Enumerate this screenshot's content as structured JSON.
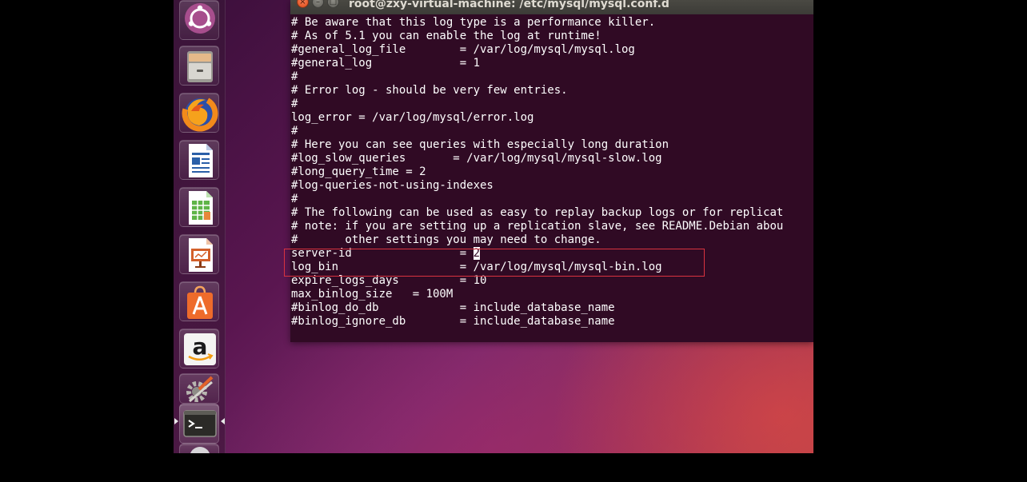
{
  "window": {
    "title": "root@zxy-virtual-machine: /etc/mysql/mysql.conf.d",
    "close_icon": "×",
    "minimize_icon": "–",
    "maximize_icon": "□"
  },
  "launcher": {
    "items": [
      {
        "name": "ubuntu-dash",
        "icon": "ubuntu-logo-icon"
      },
      {
        "name": "files",
        "icon": "file-cabinet-icon"
      },
      {
        "name": "firefox",
        "icon": "firefox-icon"
      },
      {
        "name": "libreoffice-writer",
        "icon": "writer-document-icon"
      },
      {
        "name": "libreoffice-calc",
        "icon": "calc-spreadsheet-icon"
      },
      {
        "name": "libreoffice-impress",
        "icon": "impress-presentation-icon"
      },
      {
        "name": "ubuntu-software",
        "icon": "shopping-bag-icon"
      },
      {
        "name": "amazon",
        "icon": "amazon-icon"
      },
      {
        "name": "system-settings",
        "icon": "settings-tools-icon"
      },
      {
        "name": "terminal",
        "icon": "terminal-icon",
        "active": true
      },
      {
        "name": "dvd",
        "icon": "disc-icon"
      }
    ]
  },
  "terminal": {
    "lines": [
      "# Be aware that this log type is a performance killer.",
      "# As of 5.1 you can enable the log at runtime!",
      "#general_log_file        = /var/log/mysql/mysql.log",
      "#general_log             = 1",
      "#",
      "# Error log - should be very few entries.",
      "#",
      "log_error = /var/log/mysql/error.log",
      "#",
      "# Here you can see queries with especially long duration",
      "#log_slow_queries       = /var/log/mysql/mysql-slow.log",
      "#long_query_time = 2",
      "#log-queries-not-using-indexes",
      "#",
      "# The following can be used as easy to replay backup logs or for replicat",
      "# note: if you are setting up a replication slave, see README.Debian abou",
      "#       other settings you may need to change.",
      "server-id                = ",
      "log_bin                  = /var/log/mysql/mysql-bin.log",
      "expire_logs_days         = 10",
      "max_binlog_size   = 100M",
      "#binlog_do_db            = include_database_name",
      "#binlog_ignore_db        = include_database_name"
    ],
    "cursor_value": "2"
  },
  "colors": {
    "terminal_bg": "#300a24",
    "terminal_fg": "#ffffff",
    "titlebar": "#3c3b37",
    "close_button": "#df4a16",
    "highlight_border": "#d9333f"
  }
}
